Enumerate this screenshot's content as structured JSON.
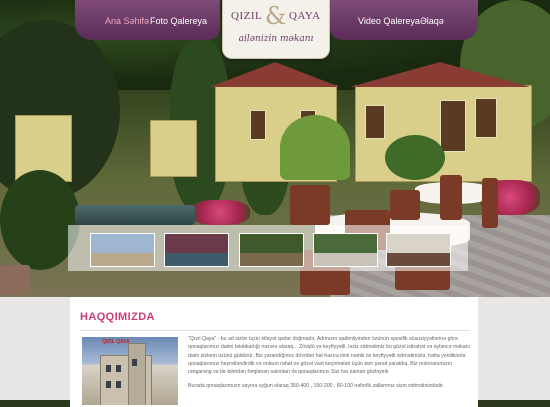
{
  "nav": {
    "left": [
      {
        "label": "Ana Səhifə",
        "active": true
      },
      {
        "label": "Foto Qalereya",
        "active": false
      }
    ],
    "right": [
      {
        "label": "Video Qalereya",
        "active": false
      },
      {
        "label": "Əlaqə",
        "active": false
      }
    ]
  },
  "logo": {
    "word_left": "QIZIL",
    "amp": "&",
    "word_right": "QAYA",
    "tagline": "ailənizin məkanı"
  },
  "content": {
    "title": "HAQQIMIZDA",
    "photo_sign": "QIZIL QAYA",
    "paragraphs": [
      "\"Qızıl Qaya\" - bu ad sizlər üçün kifayət qədər doğmadır. Adımızın qədimliyindən özünün spesifik xüsusiyyətlərinə görə qonaqlarımızı daimi tələbkarlığı nəzərə alaraq... Zövqlü və keyfiyyətli, ləziz xidmətimiz bu gözəl istirahət və əyləncə məkanı daim sizlərin üzünü güldürür. Biz yarandığımız dövrdən hal-hazıra kimi nəinki öz keyfiyyətli xidmətimizlə, hətta yeniliklərlə qonaqlarımızı heyrətləndirdik və onların rahat və gözəl vaxt keçirmələri üçün tam şərait yaratdıq. Biz restoranımızın rəngarəng və bir-birindən fərqlənən salonları ilə qonaqlarımızı Sizi hər zaman gözləyirik",
      "Burada qonaqlarımızın sayına uyğun olaraq 350-400 , 150-200 , 80-100 nəfərlik zallarımız sizin xidmətinizdədir."
    ]
  },
  "thumbnails": [
    {
      "label": "building-thumbnail"
    },
    {
      "label": "event-tent-thumbnail"
    },
    {
      "label": "garden-thumbnail"
    },
    {
      "label": "outdoor-tables-thumbnail"
    },
    {
      "label": "dining-hall-thumbnail"
    }
  ],
  "colors": {
    "nav_purple": "#6b3a66",
    "active_pink": "#f2a7c2",
    "title_pink": "#cc3d7a",
    "body_gray": "#6b6363"
  }
}
